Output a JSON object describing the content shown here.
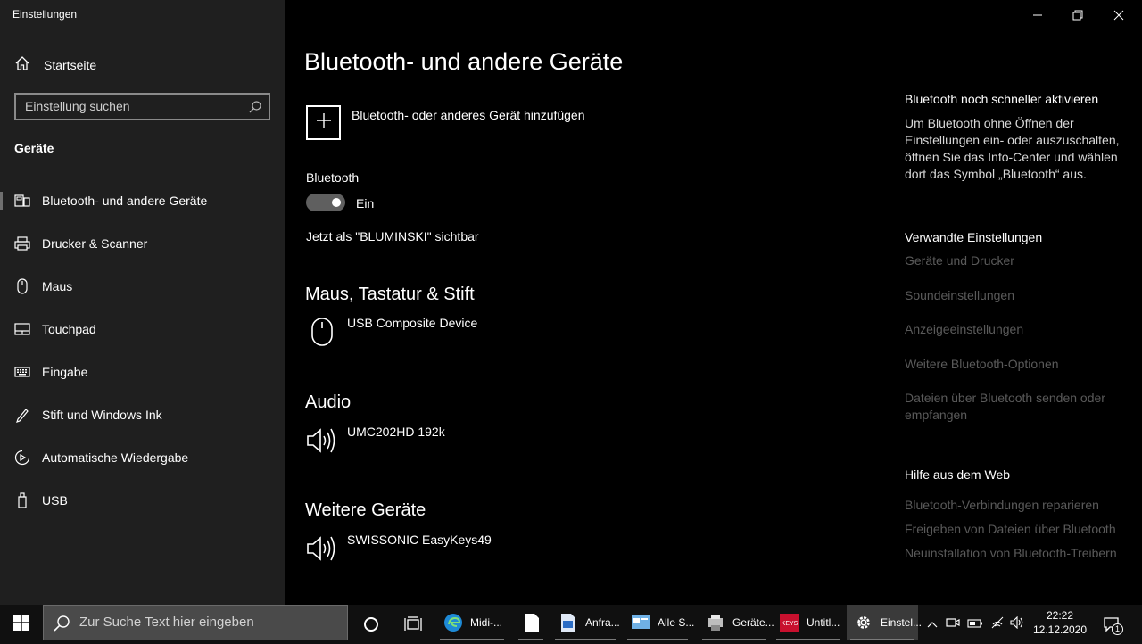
{
  "window": {
    "title": "Einstellungen"
  },
  "sidebar": {
    "home_label": "Startseite",
    "search_placeholder": "Einstellung suchen",
    "section": "Geräte",
    "items": [
      {
        "label": "Bluetooth- und andere Geräte",
        "icon": "bluetooth-devices-icon",
        "active": true
      },
      {
        "label": "Drucker & Scanner",
        "icon": "printer-icon"
      },
      {
        "label": "Maus",
        "icon": "mouse-icon"
      },
      {
        "label": "Touchpad",
        "icon": "touchpad-icon"
      },
      {
        "label": "Eingabe",
        "icon": "keyboard-icon"
      },
      {
        "label": "Stift und Windows Ink",
        "icon": "pen-icon"
      },
      {
        "label": "Automatische Wiedergabe",
        "icon": "autoplay-icon"
      },
      {
        "label": "USB",
        "icon": "usb-icon"
      }
    ]
  },
  "main": {
    "title": "Bluetooth- und andere Geräte",
    "add_device_label": "Bluetooth- oder anderes Gerät hinzufügen",
    "bluetooth_label": "Bluetooth",
    "bluetooth_state": "Ein",
    "visible_as": "Jetzt als \"BLUMINSKI\" sichtbar",
    "groups": [
      {
        "title": "Maus, Tastatur & Stift",
        "device": "USB Composite Device",
        "icon": "mouse-icon"
      },
      {
        "title": "Audio",
        "device": "UMC202HD 192k",
        "icon": "speaker-icon"
      },
      {
        "title": "Weitere Geräte",
        "device": "SWISSONIC EasyKeys49",
        "icon": "speaker-icon"
      }
    ]
  },
  "right": {
    "quick_title": "Bluetooth noch schneller aktivieren",
    "quick_text": "Um Bluetooth ohne Öffnen der Einstellungen ein- oder auszuschalten, öffnen Sie das Info-Center und wählen dort das Symbol „Bluetooth“ aus.",
    "related_title": "Verwandte Einstellungen",
    "related_links": [
      "Geräte und Drucker",
      "Soundeinstellungen",
      "Anzeigeeinstellungen",
      "Weitere Bluetooth-Optionen",
      "Dateien über Bluetooth senden oder empfangen"
    ],
    "help_title": "Hilfe aus dem Web",
    "help_links": [
      "Bluetooth-Verbindungen reparieren",
      "Freigeben von Dateien über Bluetooth",
      "Neuinstallation von Bluetooth-Treibern"
    ]
  },
  "taskbar": {
    "search_placeholder": "Zur Suche Text hier eingeben",
    "apps": [
      {
        "label": "Midi-...",
        "icon": "edge-icon"
      },
      {
        "label": "",
        "icon": "document-icon"
      },
      {
        "label": "Anfra...",
        "icon": "word-document-icon"
      },
      {
        "label": "Alle S...",
        "icon": "control-panel-icon"
      },
      {
        "label": "Geräte...",
        "icon": "devices-printers-icon"
      },
      {
        "label": "Untitl...",
        "icon": "keys-app-icon"
      },
      {
        "label": "Einstel...",
        "icon": "settings-gear-icon"
      }
    ],
    "time": "22:22",
    "date": "12.12.2020",
    "notification_count": "1",
    "colors": {
      "taskbar_bg": "#101010",
      "accent_keys": "#c8102e"
    }
  }
}
